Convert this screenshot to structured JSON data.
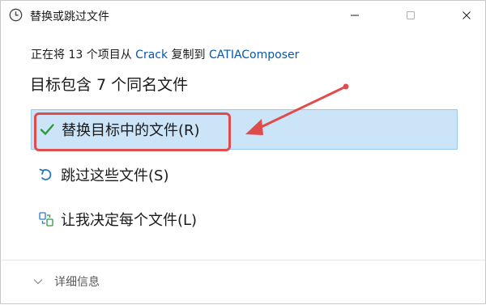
{
  "window": {
    "title": "替换或跳过文件",
    "icons": [
      "clock-icon",
      "minimize-icon",
      "maximize-icon",
      "close-icon"
    ]
  },
  "copy_info": {
    "prefix": "正在将 13 个项目从 ",
    "source": "Crack",
    "middle": " 复制到 ",
    "destination": "CATIAComposer"
  },
  "heading": "目标包含 7 个同名文件",
  "options": [
    {
      "label": "替换目标中的文件(R)",
      "icon": "checkmark-icon",
      "selected": true
    },
    {
      "label": "跳过这些文件(S)",
      "icon": "skip-undo-icon",
      "selected": false
    },
    {
      "label": "让我决定每个文件(L)",
      "icon": "decide-files-icon",
      "selected": false
    }
  ],
  "details": {
    "label": "详细信息",
    "icon": "chevron-down-icon"
  },
  "colors": {
    "selected_bg": "#cce4f7",
    "link": "#0a56a8",
    "annotation_red": "#e04b4b"
  }
}
